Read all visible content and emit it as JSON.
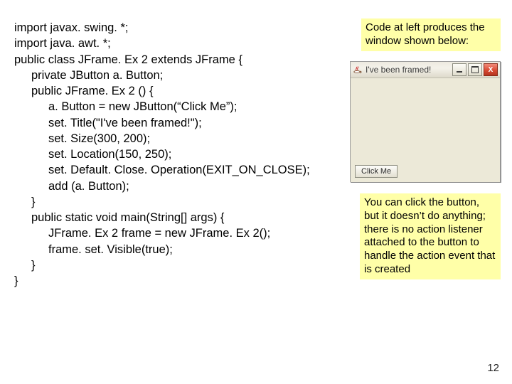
{
  "code": {
    "l01": "import javax. swing. *;",
    "l02": "import java. awt. *;",
    "l03": "",
    "l04": "public class JFrame. Ex 2 extends JFrame {",
    "l05": "private JButton a. Button;",
    "l06": "public JFrame. Ex 2 () {",
    "l07": "a. Button = new JButton(“Click Me”);",
    "l08": "set. Title(\"I've been framed!\");",
    "l09": "set. Size(300, 200);",
    "l10": "set. Location(150, 250);",
    "l11": "set. Default. Close. Operation(EXIT_ON_CLOSE);",
    "l12": "add (a. Button);",
    "l13": "}",
    "l14": "",
    "l15": "public static void main(String[] args) {",
    "l16": "JFrame. Ex 2 frame = new JFrame. Ex 2();",
    "l17": "frame. set. Visible(true);",
    "l18": "}",
    "l19": "}"
  },
  "captions": {
    "top": "Code at left produces the window shown below:",
    "bottom": "You can click the button, but it doesn’t do anything; there is no action listener attached to the button to handle the action event that is created"
  },
  "window": {
    "title": "I've been framed!",
    "button_label": "Click Me",
    "close_glyph": "X"
  },
  "page_number": "12"
}
